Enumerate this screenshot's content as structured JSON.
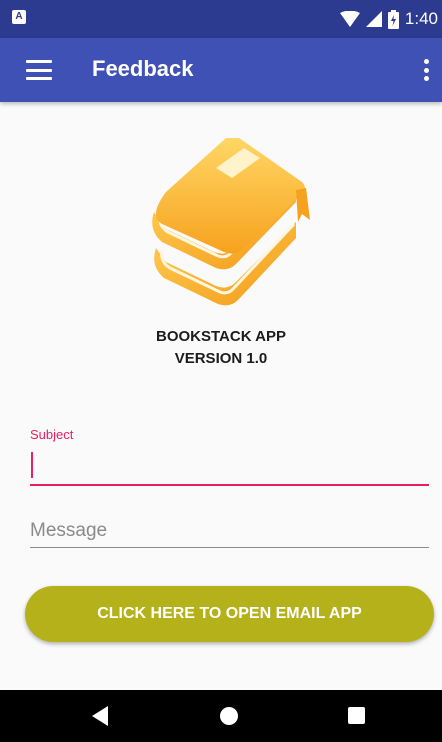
{
  "status_bar": {
    "notification_icon": "A",
    "time": "1:40",
    "icons": [
      "wifi-icon",
      "cell-signal-icon",
      "battery-icon"
    ]
  },
  "app_bar": {
    "title": "Feedback",
    "menu_icon": "hamburger-menu-icon",
    "overflow_icon": "more-vert-icon",
    "color": "#3f51b5"
  },
  "about": {
    "app_name": "BOOKSTACK APP",
    "version": "VERSION 1.0",
    "logo_icon": "book-stack-icon"
  },
  "form": {
    "subject_label": "Subject",
    "subject_value": "",
    "message_placeholder": "Message",
    "message_value": "",
    "accent_color": "#e91e63"
  },
  "button": {
    "label": "CLICK HERE TO OPEN EMAIL APP",
    "color": "#b5b11a"
  },
  "nav_bar": {
    "icons": [
      "back-icon",
      "home-icon",
      "recents-icon"
    ]
  }
}
